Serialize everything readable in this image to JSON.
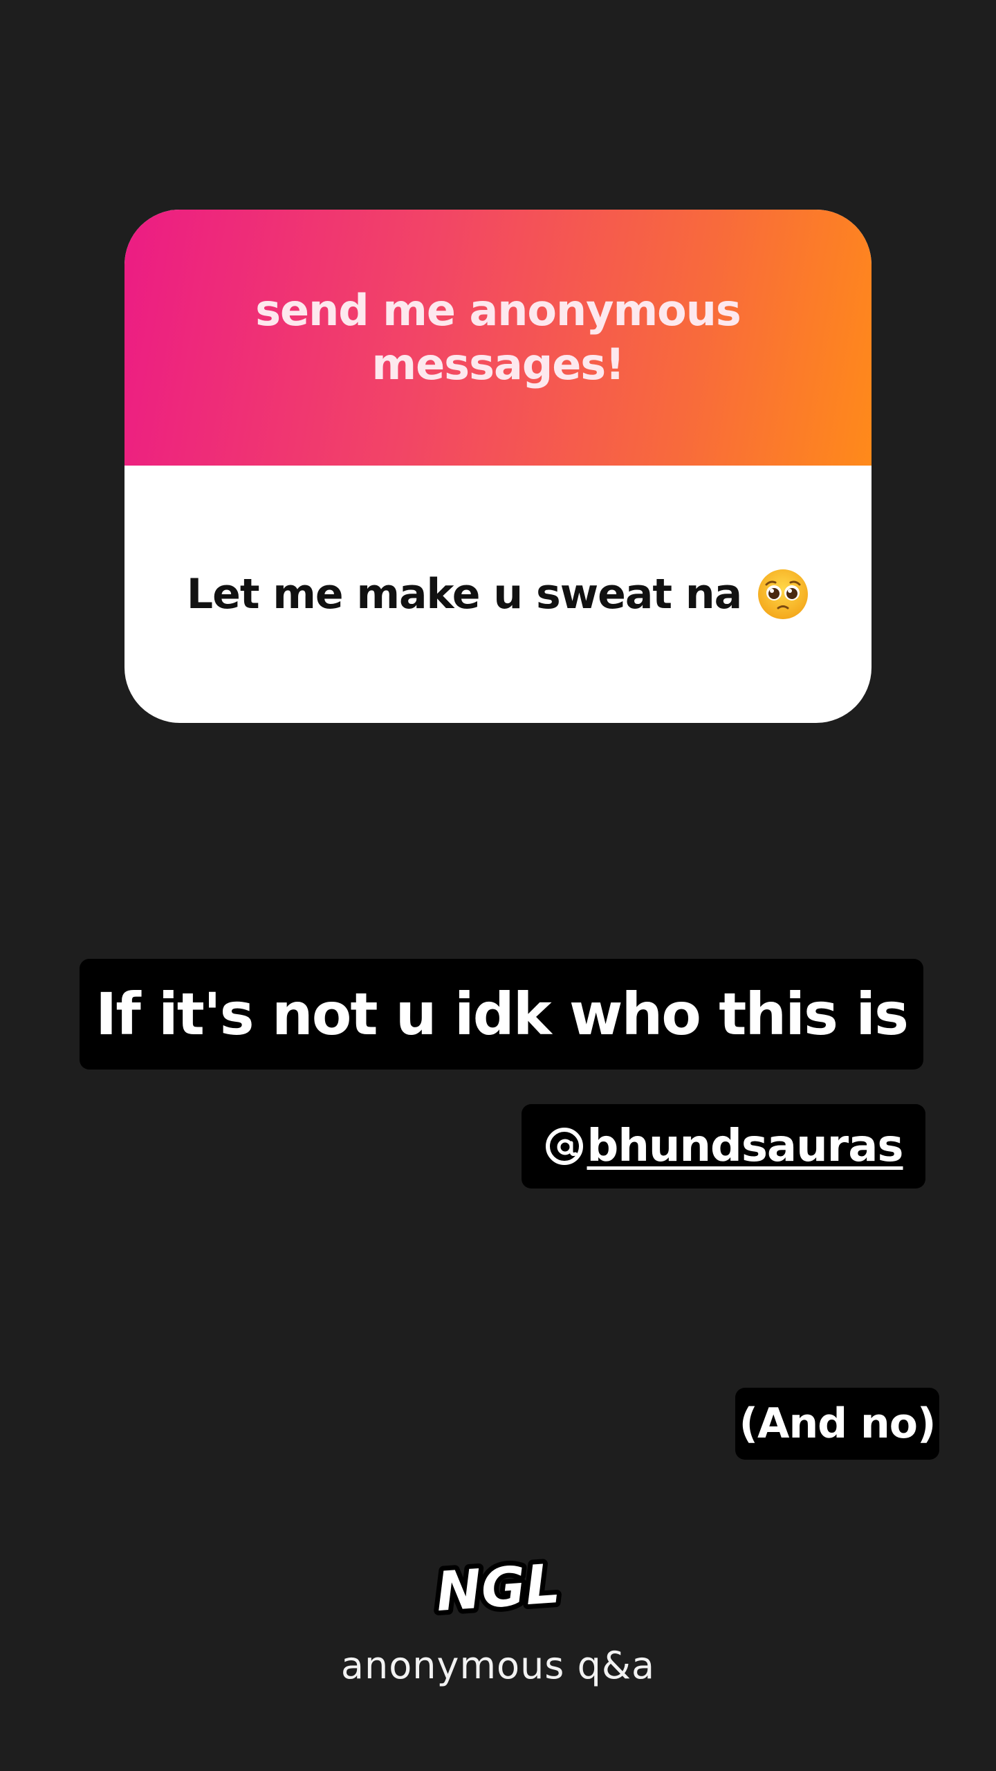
{
  "ngl_card": {
    "prompt": "send me anonymous messages!",
    "message": "Let me make u sweat na",
    "message_emoji": "pleading-face-icon",
    "header_gradient": [
      "#ec1c84",
      "#ff8a1a"
    ]
  },
  "caption": {
    "text": "If it's not u idk who this is"
  },
  "mention": {
    "icon": "threads-icon",
    "handle": "bhundsauras"
  },
  "aside": {
    "text": "(And no)"
  },
  "footer": {
    "logo": "NGL",
    "caption": "anonymous q&a"
  },
  "colors": {
    "background": "#1e1e1e",
    "sticker": "#000000"
  }
}
